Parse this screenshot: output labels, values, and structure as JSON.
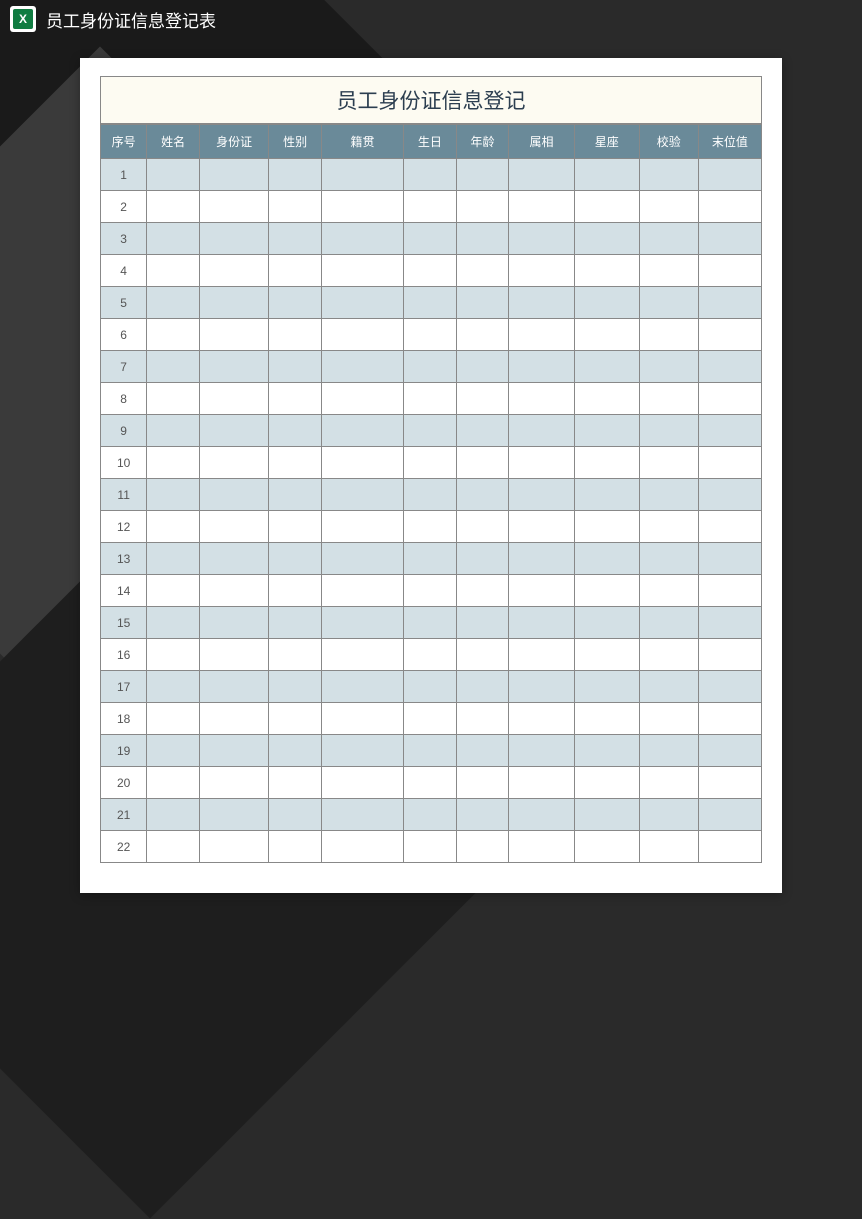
{
  "header": {
    "page_title": "员工身份证信息登记表",
    "icon_letter": "X"
  },
  "document": {
    "title": "员工身份证信息登记",
    "columns": [
      "序号",
      "姓名",
      "身份证",
      "性别",
      "籍贯",
      "生日",
      "年龄",
      "属相",
      "星座",
      "校验",
      "末位值"
    ],
    "rows": [
      {
        "num": "1"
      },
      {
        "num": "2"
      },
      {
        "num": "3"
      },
      {
        "num": "4"
      },
      {
        "num": "5"
      },
      {
        "num": "6"
      },
      {
        "num": "7"
      },
      {
        "num": "8"
      },
      {
        "num": "9"
      },
      {
        "num": "10"
      },
      {
        "num": "11"
      },
      {
        "num": "12"
      },
      {
        "num": "13"
      },
      {
        "num": "14"
      },
      {
        "num": "15"
      },
      {
        "num": "16"
      },
      {
        "num": "17"
      },
      {
        "num": "18"
      },
      {
        "num": "19"
      },
      {
        "num": "20"
      },
      {
        "num": "21"
      },
      {
        "num": "22"
      }
    ]
  }
}
